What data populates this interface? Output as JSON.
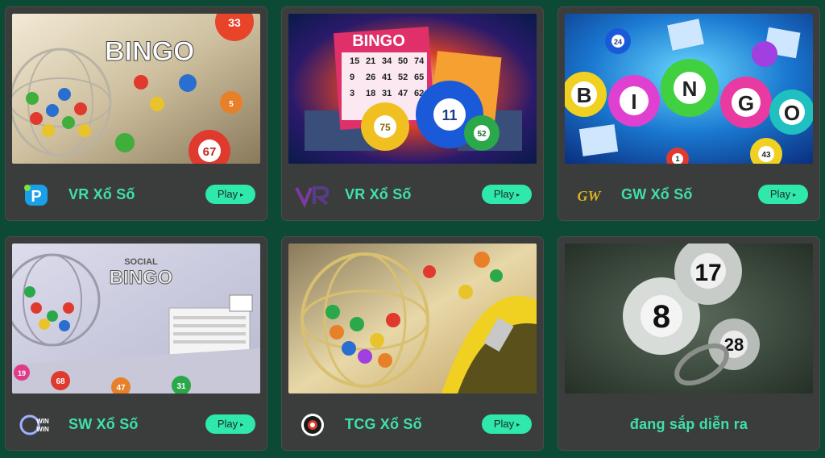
{
  "colors": {
    "background": "#0d4a36",
    "card": "#3b3d3c",
    "accent": "#3fe0a8",
    "play_button": "#2ee8ac"
  },
  "games": [
    {
      "title": "VR Xổ Số",
      "play_label": "Play",
      "arrow": "▸",
      "logo_icon": "p-provider-logo-icon",
      "thumb_text": "BINGO",
      "ball_numbers": [
        "33",
        "67",
        "5"
      ]
    },
    {
      "title": "VR Xổ Số",
      "play_label": "Play",
      "arrow": "▸",
      "logo_icon": "vr-logo-icon",
      "thumb_text": "BINGO",
      "ball_numbers": [
        "11",
        "75",
        "52"
      ],
      "card_numbers": [
        "15",
        "21",
        "34",
        "50",
        "74",
        "9",
        "26",
        "41",
        "52",
        "65",
        "3",
        "18",
        "31",
        "47",
        "62"
      ]
    },
    {
      "title": "GW Xổ Số",
      "play_label": "Play",
      "arrow": "▸",
      "logo_icon": "gw-logo-icon",
      "logo_text": "GW",
      "thumb_letters": [
        "B",
        "I",
        "N",
        "G",
        "O"
      ],
      "ball_numbers": [
        "24",
        "43",
        "1"
      ]
    },
    {
      "title": "SW Xổ Số",
      "play_label": "Play",
      "arrow": "▸",
      "logo_icon": "winwin-logo-icon",
      "logo_text": "WIN WIN",
      "thumb_text_top": "SOCIAL",
      "thumb_text": "BINGO",
      "ball_numbers": [
        "68",
        "47",
        "19",
        "31"
      ]
    },
    {
      "title": "TCG Xổ Số",
      "play_label": "Play",
      "arrow": "▸",
      "logo_icon": "tcg-logo-icon"
    },
    {
      "title": "đang sắp diễn ra",
      "ball_numbers": [
        "8",
        "17",
        "28"
      ]
    }
  ]
}
